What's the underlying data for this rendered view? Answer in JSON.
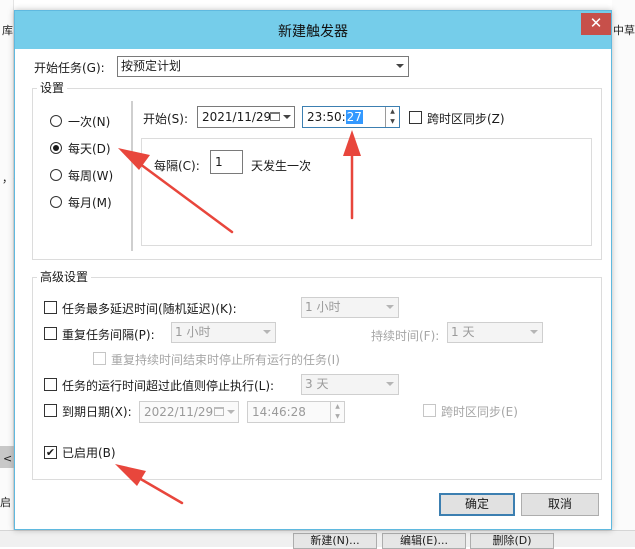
{
  "background": {
    "left_frag_1": "库",
    "left_frag_2": "，(",
    "left_frag_3": "<",
    "left_frag_4": "启",
    "right_frag_1": "中草",
    "bottom_buttons": [
      "新建(N)...",
      "编辑(E)...",
      "删除(D)"
    ]
  },
  "dialog": {
    "title": "新建触发器",
    "close": "✕",
    "start_task_label": "开始任务(G):",
    "start_task_value": "按预定计划",
    "settings_title": "设置",
    "schedule_options": [
      {
        "label": "一次(N)",
        "checked": false
      },
      {
        "label": "每天(D)",
        "checked": true
      },
      {
        "label": "每周(W)",
        "checked": false
      },
      {
        "label": "每月(M)",
        "checked": false
      }
    ],
    "start_label": "开始(S):",
    "start_date": "2021/11/29",
    "start_time_prefix": "23:50:",
    "start_time_selected": "27",
    "sync_timezone_label": "跨时区同步(Z)",
    "recur_label": "每隔(C):",
    "recur_value": "1",
    "recur_suffix": "天发生一次",
    "advanced_title": "高级设置",
    "delay_label": "任务最多延迟时间(随机延迟)(K):",
    "delay_value": "1 小时",
    "repeat_label": "重复任务间隔(P):",
    "repeat_value": "1 小时",
    "duration_label": "持续时间(F):",
    "duration_value": "1 天",
    "stop_repeat_label": "重复持续时间结束时停止所有运行的任务(I)",
    "stop_if_label": "任务的运行时间超过此值则停止执行(L):",
    "stop_if_value": "3 天",
    "expire_label": "到期日期(X):",
    "expire_date": "2022/11/29",
    "expire_time": "14:46:28",
    "expire_sync_label": "跨时区同步(E)",
    "enabled_label": "已启用(B)",
    "enabled_check": "✔",
    "ok": "确定",
    "cancel": "取消"
  },
  "annotation_color": "#e8463c"
}
